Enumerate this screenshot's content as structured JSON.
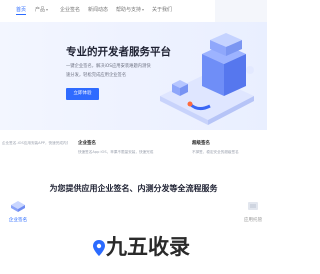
{
  "nav": {
    "items": [
      {
        "label": "首页"
      },
      {
        "label": "产品"
      },
      {
        "label": "企业签名"
      },
      {
        "label": "新闻动态"
      },
      {
        "label": "帮助与支持"
      },
      {
        "label": "关于我们"
      }
    ]
  },
  "hero": {
    "title": "专业的开发者服务平台",
    "description": "一键企业签名，解决iOS应用安装难题内测快速分发，轻松完成应用企业签名",
    "button_label": "立即体验",
    "accent": "#2f6bff"
  },
  "cards": [
    {
      "title": "",
      "desc": "企业签名-iOS应用安装APP，快速完成内测..."
    },
    {
      "title": "企业签名",
      "desc": "快速签名App iOS，苹果不限量安装，快速完成"
    },
    {
      "title": "超级签名",
      "desc": "不掉签，稳定安全的超级签名"
    }
  ],
  "section": {
    "title": "为您提供应用企业签名、内测分发等全流程服务"
  },
  "tabs": [
    {
      "label": "企业签名"
    },
    {
      "label": "应用托管"
    }
  ],
  "watermark": {
    "text": "九五收录"
  }
}
